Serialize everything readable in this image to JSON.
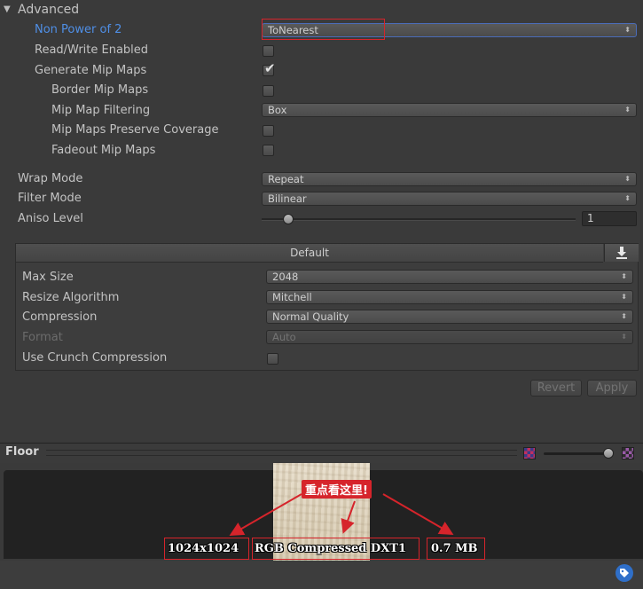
{
  "advanced": {
    "title": "Advanced",
    "non_power_of_2": {
      "label": "Non Power of 2",
      "value": "ToNearest"
    },
    "read_write": {
      "label": "Read/Write Enabled",
      "checked": false
    },
    "generate_mip_maps": {
      "label": "Generate Mip Maps",
      "checked": true
    },
    "border_mip_maps": {
      "label": "Border Mip Maps",
      "checked": false
    },
    "mip_map_filtering": {
      "label": "Mip Map Filtering",
      "value": "Box"
    },
    "mip_maps_preserve_coverage": {
      "label": "Mip Maps Preserve Coverage",
      "checked": false
    },
    "fadeout_mip_maps": {
      "label": "Fadeout Mip Maps",
      "checked": false
    }
  },
  "wrap_mode": {
    "label": "Wrap Mode",
    "value": "Repeat"
  },
  "filter_mode": {
    "label": "Filter Mode",
    "value": "Bilinear"
  },
  "aniso_level": {
    "label": "Aniso Level",
    "value": "1",
    "slider_fraction": 0.07
  },
  "platform": {
    "tab_label": "Default",
    "max_size": {
      "label": "Max Size",
      "value": "2048"
    },
    "resize_algorithm": {
      "label": "Resize Algorithm",
      "value": "Mitchell"
    },
    "compression": {
      "label": "Compression",
      "value": "Normal Quality"
    },
    "format": {
      "label": "Format",
      "value": "Auto"
    },
    "use_crunch": {
      "label": "Use Crunch Compression",
      "checked": false
    }
  },
  "buttons": {
    "revert": "Revert",
    "apply": "Apply"
  },
  "preview": {
    "title": "Floor",
    "annotation": "重点看这里!",
    "resolution": "1024x1024",
    "format": "RGB Compressed DXT1",
    "size": "0.7 MB"
  },
  "colors": {
    "accent_blue": "#4f8fe6",
    "highlight_red": "#d6242b"
  }
}
